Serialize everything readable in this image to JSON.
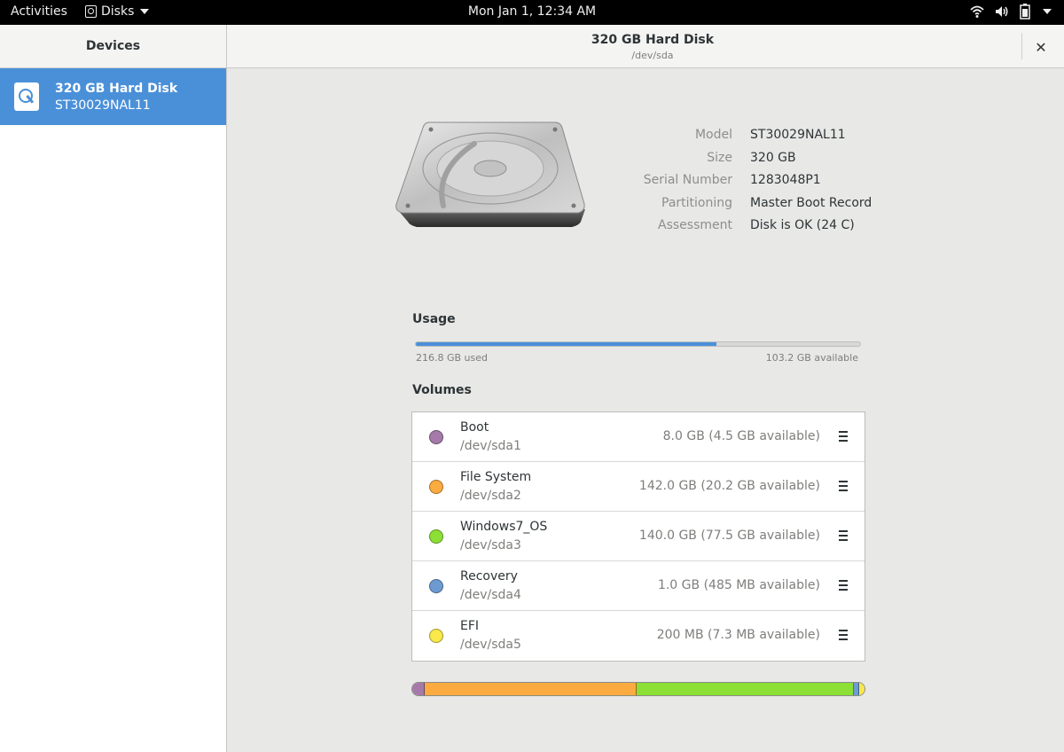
{
  "topbar": {
    "activities": "Activities",
    "app_name": "Disks",
    "clock": "Mon Jan 1, 12:34 AM",
    "tray_icons": [
      "wifi-icon",
      "volume-icon",
      "battery-icon"
    ]
  },
  "sidebar": {
    "title": "Devices",
    "devices": [
      {
        "name": "320 GB Hard Disk",
        "model": "ST30029NAL11",
        "selected": true
      }
    ]
  },
  "header": {
    "title": "320 GB Hard Disk",
    "subtitle": "/dev/sda",
    "close_icon": "close-icon"
  },
  "info": {
    "rows": [
      {
        "label": "Model",
        "value": "ST30029NAL11"
      },
      {
        "label": "Size",
        "value": "320 GB"
      },
      {
        "label": "Serial Number",
        "value": "1283048P1"
      },
      {
        "label": "Partitioning",
        "value": "Master Boot Record"
      },
      {
        "label": "Assessment",
        "value": "Disk is OK (24 C)"
      }
    ]
  },
  "usage": {
    "title": "Usage",
    "used_label": "216.8 GB used",
    "available_label": "103.2 GB available",
    "fraction_used": 0.6775,
    "color": "#4a90d9"
  },
  "volumes": {
    "title": "Volumes",
    "items": [
      {
        "name": "Boot",
        "device": "/dev/sda1",
        "size": "8.0 GB (4.5 GB available)",
        "color": "#a57aa8",
        "share": 0.025
      },
      {
        "name": "File System",
        "device": "/dev/sda2",
        "size": "142.0 GB (20.2 GB available)",
        "color": "#fbab3f",
        "share": 0.444
      },
      {
        "name": "Windows7_OS",
        "device": "/dev/sda3",
        "size": "140.0 GB (77.5 GB available)",
        "color": "#8cdf34",
        "share": 0.4375
      },
      {
        "name": "Recovery",
        "device": "/dev/sda4",
        "size": "1.0 GB (485 MB available)",
        "color": "#6d9bd1",
        "share": 0.003
      },
      {
        "name": "EFI",
        "device": "/dev/sda5",
        "size": "200 MB (7.3 MB available)",
        "color": "#f8e84a",
        "share": 0.0006
      }
    ]
  }
}
